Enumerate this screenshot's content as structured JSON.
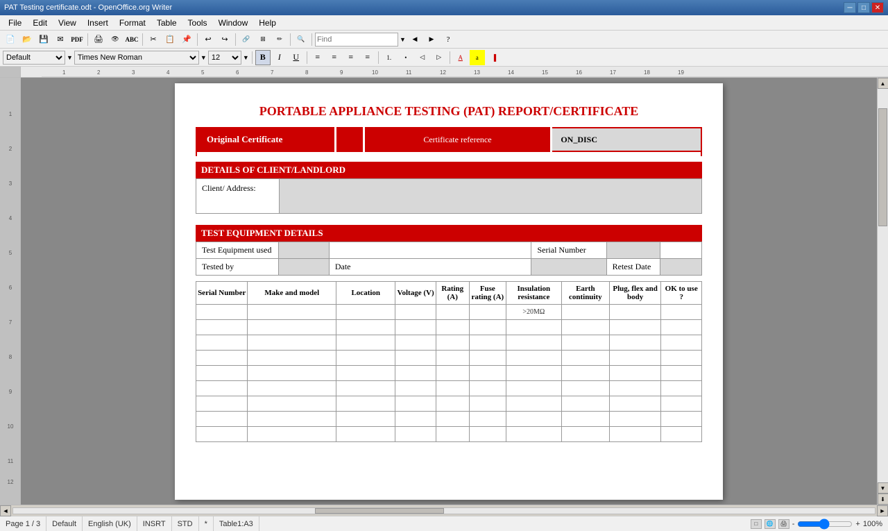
{
  "titlebar": {
    "title": "PAT Testing certificate.odt - OpenOffice.org Writer",
    "minimize": "─",
    "maximize": "□",
    "close": "✕"
  },
  "menubar": {
    "items": [
      "File",
      "Edit",
      "View",
      "Insert",
      "Format",
      "Table",
      "Tools",
      "Window",
      "Help"
    ]
  },
  "toolbar1": {
    "find_placeholder": "Find"
  },
  "toolbar2": {
    "style": "Default",
    "font": "Times New Roman",
    "size": "12",
    "bold": "B",
    "italic": "I",
    "underline": "U"
  },
  "document": {
    "title": "PORTABLE APPLIANCE TESTING (PAT) REPORT/CERTIFICATE",
    "cert_original": "Original Certificate",
    "cert_ref_label": "Certificate reference",
    "cert_ref_value": "ON_DISC",
    "section1_title": "DETAILS OF CLIENT/LANDLORD",
    "client_label": "Client/ Address:",
    "section2_title": "TEST EQUIPMENT DETAILS",
    "equip_label": "Test Equipment used",
    "serial_label": "Serial Number",
    "tested_label": "Tested by",
    "date_label": "Date",
    "retest_label": "Retest Date",
    "table_headers": [
      "Serial Number",
      "Make and model",
      "Location",
      "Voltage (V)",
      "Rating (A)",
      "Fuse rating (A)",
      "Insulation resistance",
      "Earth continuity",
      "Plug, flex and body",
      "OK to use ?"
    ],
    "insulation_note": ">20MΩ",
    "empty_rows": 8
  },
  "statusbar": {
    "page": "Page 1 / 3",
    "style": "Default",
    "language": "English (UK)",
    "mode": "INSRT",
    "std": "STD",
    "star": "*",
    "table_ref": "Table1:A3",
    "zoom": "100%"
  }
}
